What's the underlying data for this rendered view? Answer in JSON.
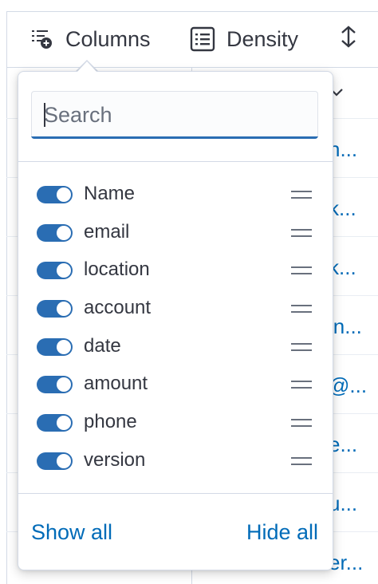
{
  "toolbar": {
    "columns_label": "Columns",
    "density_label": "Density"
  },
  "grid_cells": [
    "n...",
    "k...",
    "k...",
    "in...",
    "@...",
    "e...",
    "u...",
    "er..."
  ],
  "popover": {
    "search": {
      "placeholder": "Search",
      "value": ""
    },
    "columns": [
      {
        "label": "Name",
        "enabled": true
      },
      {
        "label": "email",
        "enabled": true
      },
      {
        "label": "location",
        "enabled": true
      },
      {
        "label": "account",
        "enabled": true
      },
      {
        "label": "date",
        "enabled": true
      },
      {
        "label": "amount",
        "enabled": true
      },
      {
        "label": "phone",
        "enabled": true
      },
      {
        "label": "version",
        "enabled": true
      }
    ],
    "show_all_label": "Show all",
    "hide_all_label": "Hide all"
  },
  "colors": {
    "accent": "#2a6db3",
    "link": "#006bb8",
    "text": "#343741",
    "border": "#d3dae6"
  },
  "icons": {
    "columns": "columns-add-icon",
    "density": "table-density-icon",
    "sort": "sort-icon",
    "drag": "drag-handle-icon"
  }
}
